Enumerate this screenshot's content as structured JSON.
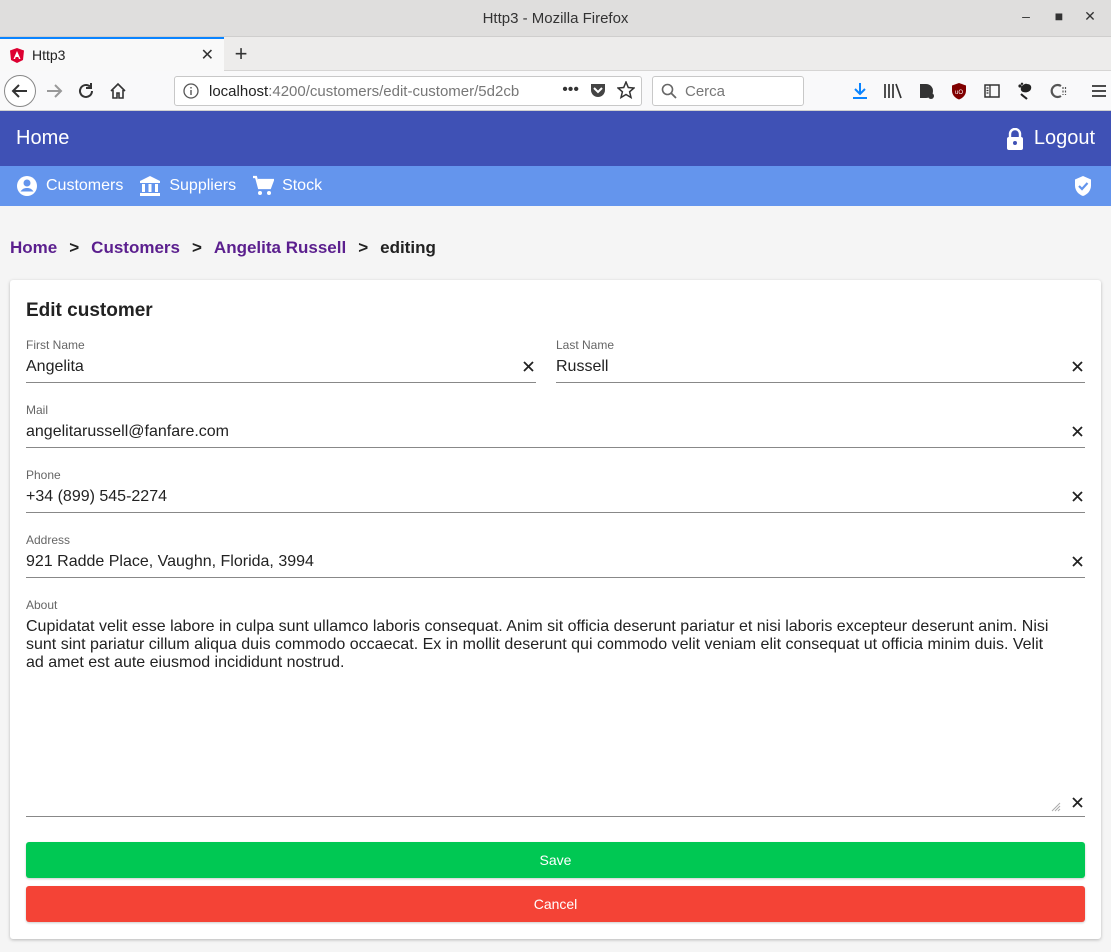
{
  "browser": {
    "window_title": "Http3 - Mozilla Firefox",
    "tab_title": "Http3",
    "url_host": "localhost",
    "url_path": ":4200/customers/edit-customer/5d2cb",
    "search_placeholder": "Cerca"
  },
  "appbar": {
    "home_label": "Home",
    "logout_label": "Logout"
  },
  "subnav": {
    "items": [
      {
        "label": "Customers",
        "icon": "account-circle-icon"
      },
      {
        "label": "Suppliers",
        "icon": "bank-icon"
      },
      {
        "label": "Stock",
        "icon": "shopping-cart-icon"
      }
    ]
  },
  "breadcrumb": {
    "home": "Home",
    "customers": "Customers",
    "customer": "Angelita Russell",
    "current": "editing",
    "separator": ">"
  },
  "form": {
    "title": "Edit customer",
    "first_name": {
      "label": "First Name",
      "value": "Angelita"
    },
    "last_name": {
      "label": "Last Name",
      "value": "Russell"
    },
    "mail": {
      "label": "Mail",
      "value": "angelitarussell@fanfare.com"
    },
    "phone": {
      "label": "Phone",
      "value": "+34 (899) 545-2274"
    },
    "address": {
      "label": "Address",
      "value": "921 Radde Place, Vaughn, Florida, 3994"
    },
    "about": {
      "label": "About",
      "value": "Cupidatat velit esse labore in culpa sunt ullamco laboris consequat. Anim sit officia deserunt pariatur et nisi laboris excepteur deserunt anim. Nisi sunt sint pariatur cillum aliqua duis commodo occaecat. Ex in mollit deserunt qui commodo velit veniam elit consequat ut officia minim duis. Velit ad amet est aute eiusmod incididunt nostrud."
    },
    "save_label": "Save",
    "cancel_label": "Cancel"
  },
  "colors": {
    "appbar": "#3f51b5",
    "subnav": "#6495ed",
    "breadcrumb_link": "#5b1f8e",
    "save": "#00c853",
    "cancel": "#f44336"
  }
}
